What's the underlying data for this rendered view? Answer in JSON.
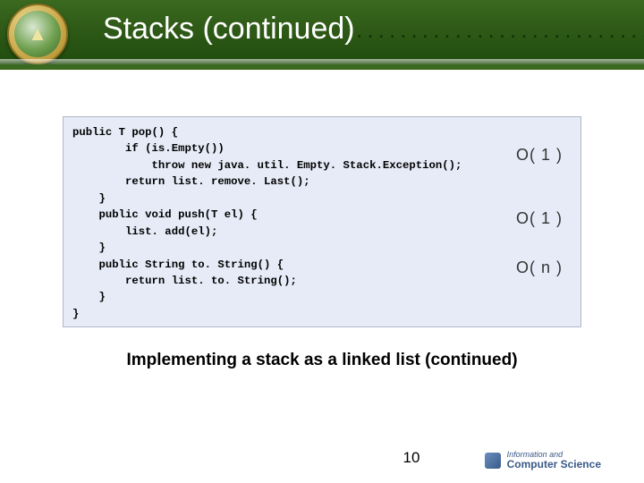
{
  "header": {
    "title": "Stacks (continued)"
  },
  "code": {
    "text": "public T pop() {\n        if (is.Empty())\n            throw new java. util. Empty. Stack.Exception();\n        return list. remove. Last();\n    }\n    public void push(T el) {\n        list. add(el);\n    }\n    public String to. String() {\n        return list. to. String();\n    }\n}"
  },
  "annotations": {
    "a1": "O( 1 )",
    "a2": "O( 1 )",
    "a3": "O( n )"
  },
  "caption": "Implementing a stack as a linked list (continued)",
  "page_number": "10",
  "footer": {
    "line1": "Information and",
    "line2": "Computer Science"
  }
}
